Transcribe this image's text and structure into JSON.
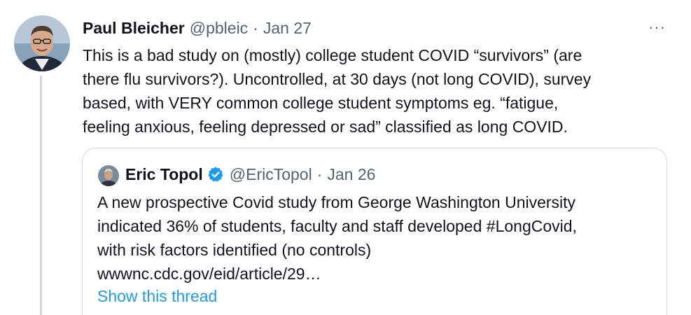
{
  "tweet": {
    "author_name": "Paul Bleicher",
    "handle": "@pbleic",
    "separator": "·",
    "date": "Jan 27",
    "more_icon": "···",
    "body_lines": [
      "This is a bad study on (mostly) college student COVID “survivors” (are",
      "there flu survivors?). Uncontrolled, at 30 days (not long COVID), survey",
      "based, with VERY common college student  symptoms eg.  “fatigue,",
      "feeling anxious, feeling depressed or sad” classified as long COVID."
    ]
  },
  "quote": {
    "author_name": "Eric Topol",
    "verified_icon": "verified-badge",
    "handle": "@EricTopol",
    "separator": "·",
    "date": "Jan 26",
    "body_lines": [
      "A new prospective Covid study from George Washington University",
      "indicated 36% of students, faculty and staff developed #LongCovid,",
      "with risk factors identified (no controls)",
      "wwwnc.cdc.gov/eid/article/29…"
    ],
    "show_thread": "Show this thread"
  },
  "colors": {
    "text": "#0f1419",
    "secondary": "#536471",
    "link": "#1d9bf0",
    "border": "#cfd9de"
  }
}
